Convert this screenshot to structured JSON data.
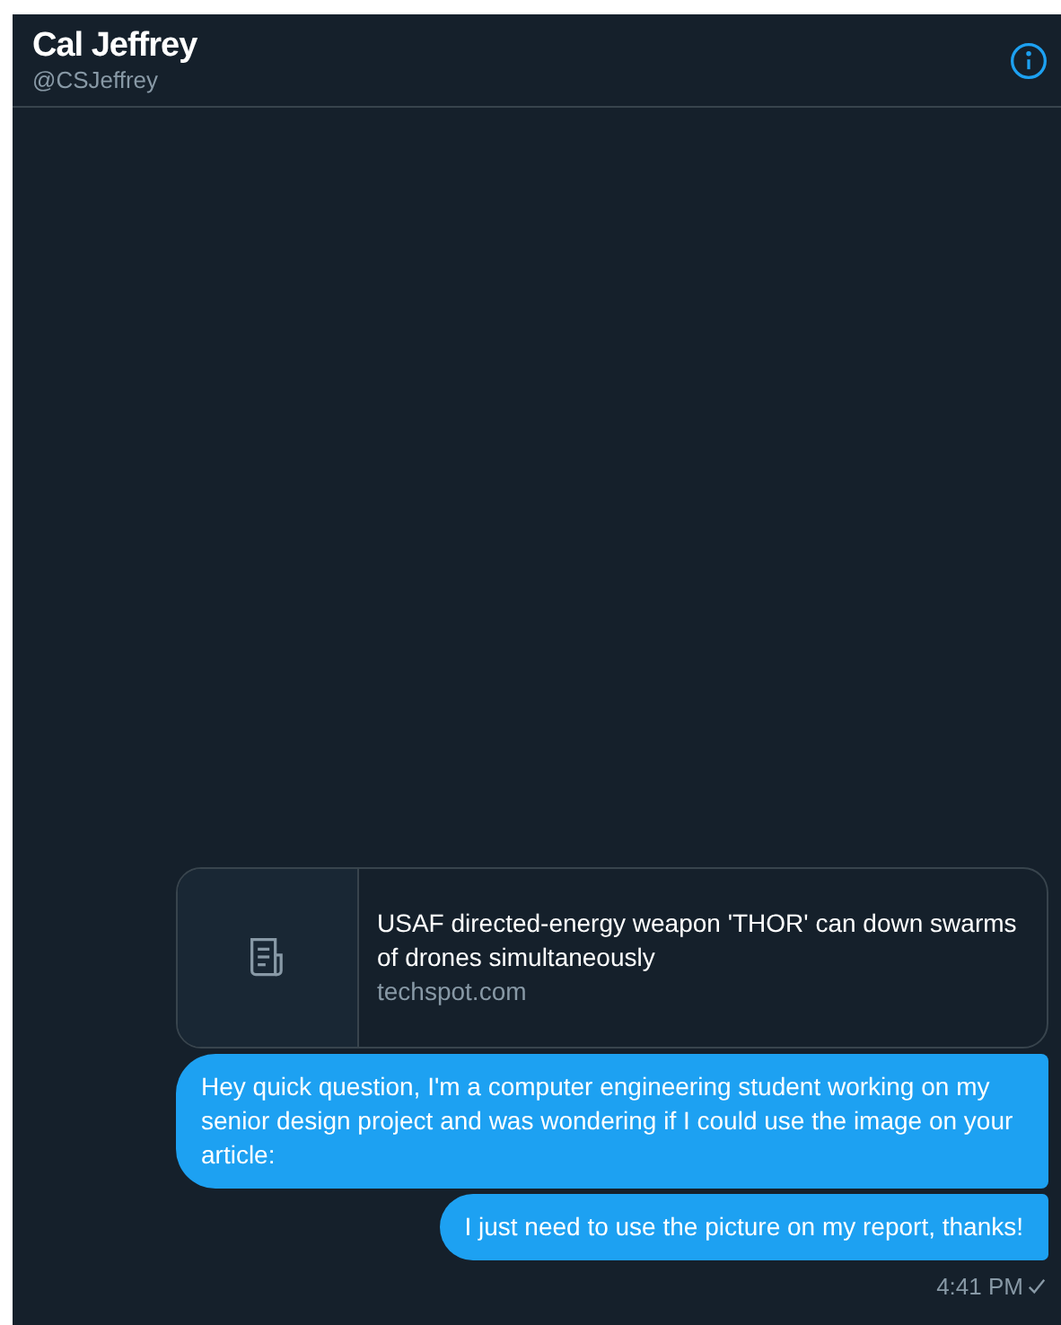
{
  "header": {
    "name": "Cal Jeffrey",
    "handle": "@CSJeffrey"
  },
  "link_card": {
    "title": "USAF directed-energy weapon 'THOR' can down swarms of drones simultaneously",
    "domain": "techspot.com"
  },
  "messages": [
    {
      "text": "Hey quick question, I'm a computer engineering student working on my senior design project and was wondering if I could use the image on your article:"
    },
    {
      "text": "I just need to use the picture on my report, thanks!"
    }
  ],
  "timestamp": "4:41 PM",
  "read": true
}
